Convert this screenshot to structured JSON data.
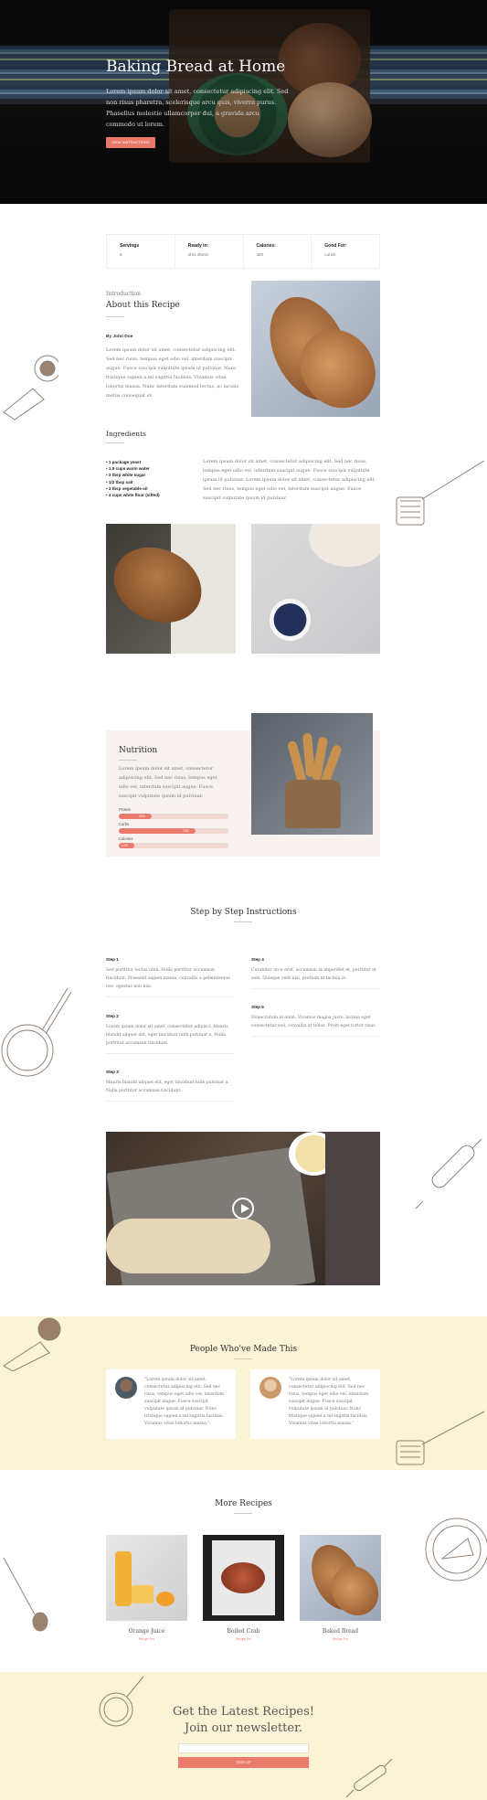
{
  "hero": {
    "title": "Baking Bread at Home",
    "description": "Lorem ipsum dolor sit amet, consectetur adipiscing elit. Sed non risus pharetra, scelerisque arcu quis, viverra purus. Phasellus molestie ullamcorper dui, a gravida arcu commodo ut lorem.",
    "button_label": "VIEW INSTRUCTIONS"
  },
  "info": [
    {
      "label": "Servings",
      "value": "6"
    },
    {
      "label": "Ready in:",
      "value": "2hrs 45min"
    },
    {
      "label": "Calories:",
      "value": "420"
    },
    {
      "label": "Good For:",
      "value": "Lunch"
    }
  ],
  "about": {
    "kicker": "Introduction",
    "title": "About this Recipe",
    "author": "By John Doe",
    "text": "Lorem ipsum dolor sit amet, consectetur adipiscing elit. Sed nec risus, tempus eget odio vel, interdum suscipit augue. Fusce suscipit vulputate ipsum id pulvinar. Nunc tristique sapien a mi sagittis facilisis. Vivamus vitae lobortis massa. Nunc interdum euismod lectus, ac iaculis metus consequat et."
  },
  "ingredients": {
    "title": "Ingredients",
    "items": [
      "1 package yeast",
      "1.5 cups warm water",
      "3 tbsp white sugar",
      "1/2 tbsp salt",
      "3 tbsp vegetable oil",
      "4 cups white flour (sifted)"
    ],
    "text": "Lorem ipsum dolor sit amet, consectetur adipiscing elit. Sed nec risus, tempus eget odio vel, interdum suscipit augue. Fusce suscipit vulputate ipsum id pulvinar. Lorem ipsum dolor sit amet, consectetur adipiscing elit. Sed nec risus, tempus eget odio vel, interdum suscipit augue. Fusce suscipit vulputate ipsum id pulvinar."
  },
  "nutrition": {
    "title": "Nutrition",
    "text": "Lorem ipsum dolor sit amet, consectetur adipiscing elit. Sed nec risus, tempus eget odio vel, interdum suscipit augue. Fusce suscipit vulputate ipsum id pulvinar.",
    "bars": [
      {
        "label": "Protein",
        "percent": 30,
        "value_label": "30%"
      },
      {
        "label": "Carbs",
        "percent": 70,
        "value_label": "70%"
      },
      {
        "label": "Calories",
        "percent": 14,
        "value_label": "14%"
      }
    ]
  },
  "steps": {
    "title": "Step by Step Instructions",
    "left": [
      {
        "title": "Step 1",
        "text": "Sed porttitor lectus nibh. Nulla porttitor accumsan tincidunt. Praesent sapien massa, convallis a pellentesque nec, egestas non nisi."
      },
      {
        "title": "Step 2",
        "text": "Lorem ipsum dolor sit amet, consectetur adipisci. Mauris blandit aliquet elit, eget tincidunt nibh pulvinar a. Nulla porttitor accumsan tincidunt."
      },
      {
        "title": "Step 3",
        "text": "Mauris blandit aliquet elit, eget tincidunt nibh pulvinar a. Nulla porttitor accumsan tincidunt."
      }
    ],
    "right": [
      {
        "title": "Step 4",
        "text": "Curabitur arcu erat, accumsan id imperdiet et, porttitor at sem. Quisque velit nisi, pretium ut lacinia in."
      },
      {
        "title": "Step 5",
        "text": "Donecrutum id enim. Vivamus magna justo, lacinia eget consectetur sed, convallis at tellus. Proin eget tortor risus."
      }
    ]
  },
  "testimonials": {
    "title": "People Who've Made This",
    "items": [
      {
        "text": "\"Lorem ipsum dolor sit amet, consectetur adipiscing elit. Sed nec risus, tempus eget odio vel, interdum suscipit augue. Fusce suscipit vulputate ipsum id pulvinar. Nunc tristique sapien a mi sagittis facilisis. Vivamus vitae lobortis massa.\""
      },
      {
        "text": "\"Lorem ipsum dolor sit amet, consectetur adipiscing elit. Sed nec risus, tempus eget odio vel, interdum suscipit augue. Fusce suscipit vulputate ipsum id pulvinar. Nunc tristique sapien a mi sagittis facilisis. Vivamus vitae lobortis massa.\""
      }
    ]
  },
  "more": {
    "title": "More Recipes",
    "items": [
      {
        "name": "Orange Juice",
        "link": "Recipe Pro"
      },
      {
        "name": "Boiled Crab",
        "link": "Recipe Pro"
      },
      {
        "name": "Baked Bread",
        "link": "Recipe Pro"
      }
    ]
  },
  "newsletter": {
    "line1": "Get the Latest Recipes!",
    "line2": "Join our newsletter.",
    "input_placeholder": "",
    "button_label": "SIGN UP"
  },
  "colors": {
    "accent": "#ea7b6d",
    "cream": "#faf3d6",
    "nutrition_bg": "#f7f2f0"
  }
}
